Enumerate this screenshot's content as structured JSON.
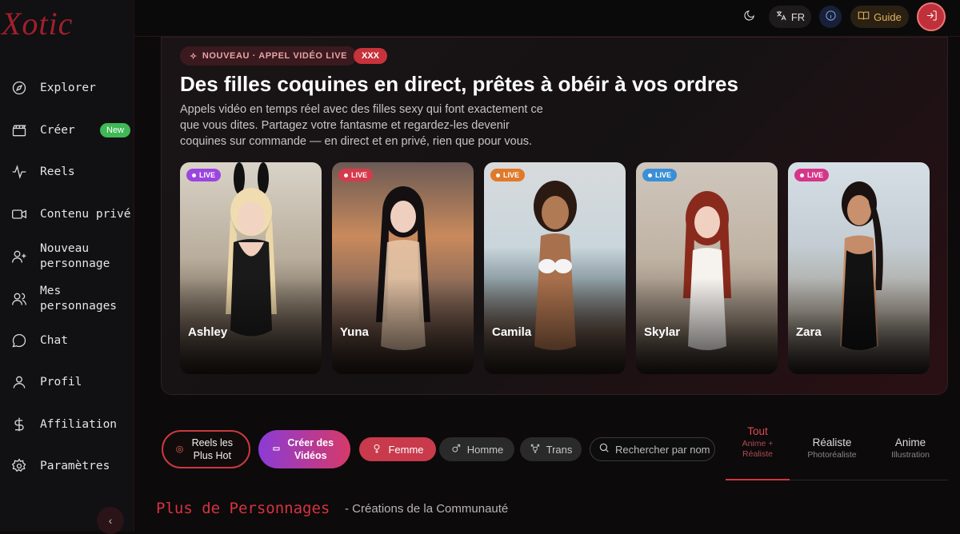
{
  "app": {
    "logo": "Xotic"
  },
  "sidebar": {
    "items": [
      {
        "label": "Explorer",
        "icon": "compass-icon"
      },
      {
        "label": "Créer",
        "icon": "clapperboard-icon",
        "badge": "New"
      },
      {
        "label": "Reels",
        "icon": "activity-icon"
      },
      {
        "label": "Contenu privé",
        "icon": "video-icon"
      },
      {
        "label": "Nouveau personnage",
        "icon": "user-plus-icon"
      },
      {
        "label": "Mes personnages",
        "icon": "users-icon"
      },
      {
        "label": "Chat",
        "icon": "chat-bubble-icon"
      },
      {
        "label": "Profil",
        "icon": "user-icon"
      },
      {
        "label": "Affiliation",
        "icon": "dollar-icon"
      },
      {
        "label": "Paramètres",
        "icon": "gear-icon"
      }
    ]
  },
  "topbar": {
    "language": "FR",
    "guide": "Guide"
  },
  "hero": {
    "pill_new": "NOUVEAU · APPEL VIDÉO LIVE",
    "pill_xxx": "XXX",
    "title": "Des filles coquines en direct, prêtes à obéir à vos ordres",
    "description": "Appels vidéo en temps réel avec des filles sexy qui font exactement ce que vous dites. Partagez votre fantasme et regardez-les devenir coquines sur commande — en direct et en privé, rien que pour vous.",
    "live_label": "LIVE",
    "cards": [
      {
        "name": "Ashley",
        "live_color": "#9b45e0"
      },
      {
        "name": "Yuna",
        "live_color": "#d63a4c"
      },
      {
        "name": "Camila",
        "live_color": "#e07a2a"
      },
      {
        "name": "Skylar",
        "live_color": "#3a8fd6"
      },
      {
        "name": "Zara",
        "live_color": "#d6368a"
      }
    ]
  },
  "filters": {
    "reels_button": "Reels les Plus Hot",
    "create_button": "Créer des Vidéos",
    "chips": [
      "Femme",
      "Homme",
      "Trans"
    ],
    "search_placeholder": "Rechercher par nom"
  },
  "style_tabs": [
    {
      "label": "Tout",
      "sub": "Anime + Réaliste",
      "active": true
    },
    {
      "label": "Réaliste",
      "sub": "Photoréaliste",
      "active": false
    },
    {
      "label": "Anime",
      "sub": "Illustration",
      "active": false
    }
  ],
  "section": {
    "title": "Plus de Personnages",
    "subtitle": "- Créations de la Communauté"
  },
  "colors": {
    "accent": "#d6333f",
    "brand": "#a0202c"
  }
}
